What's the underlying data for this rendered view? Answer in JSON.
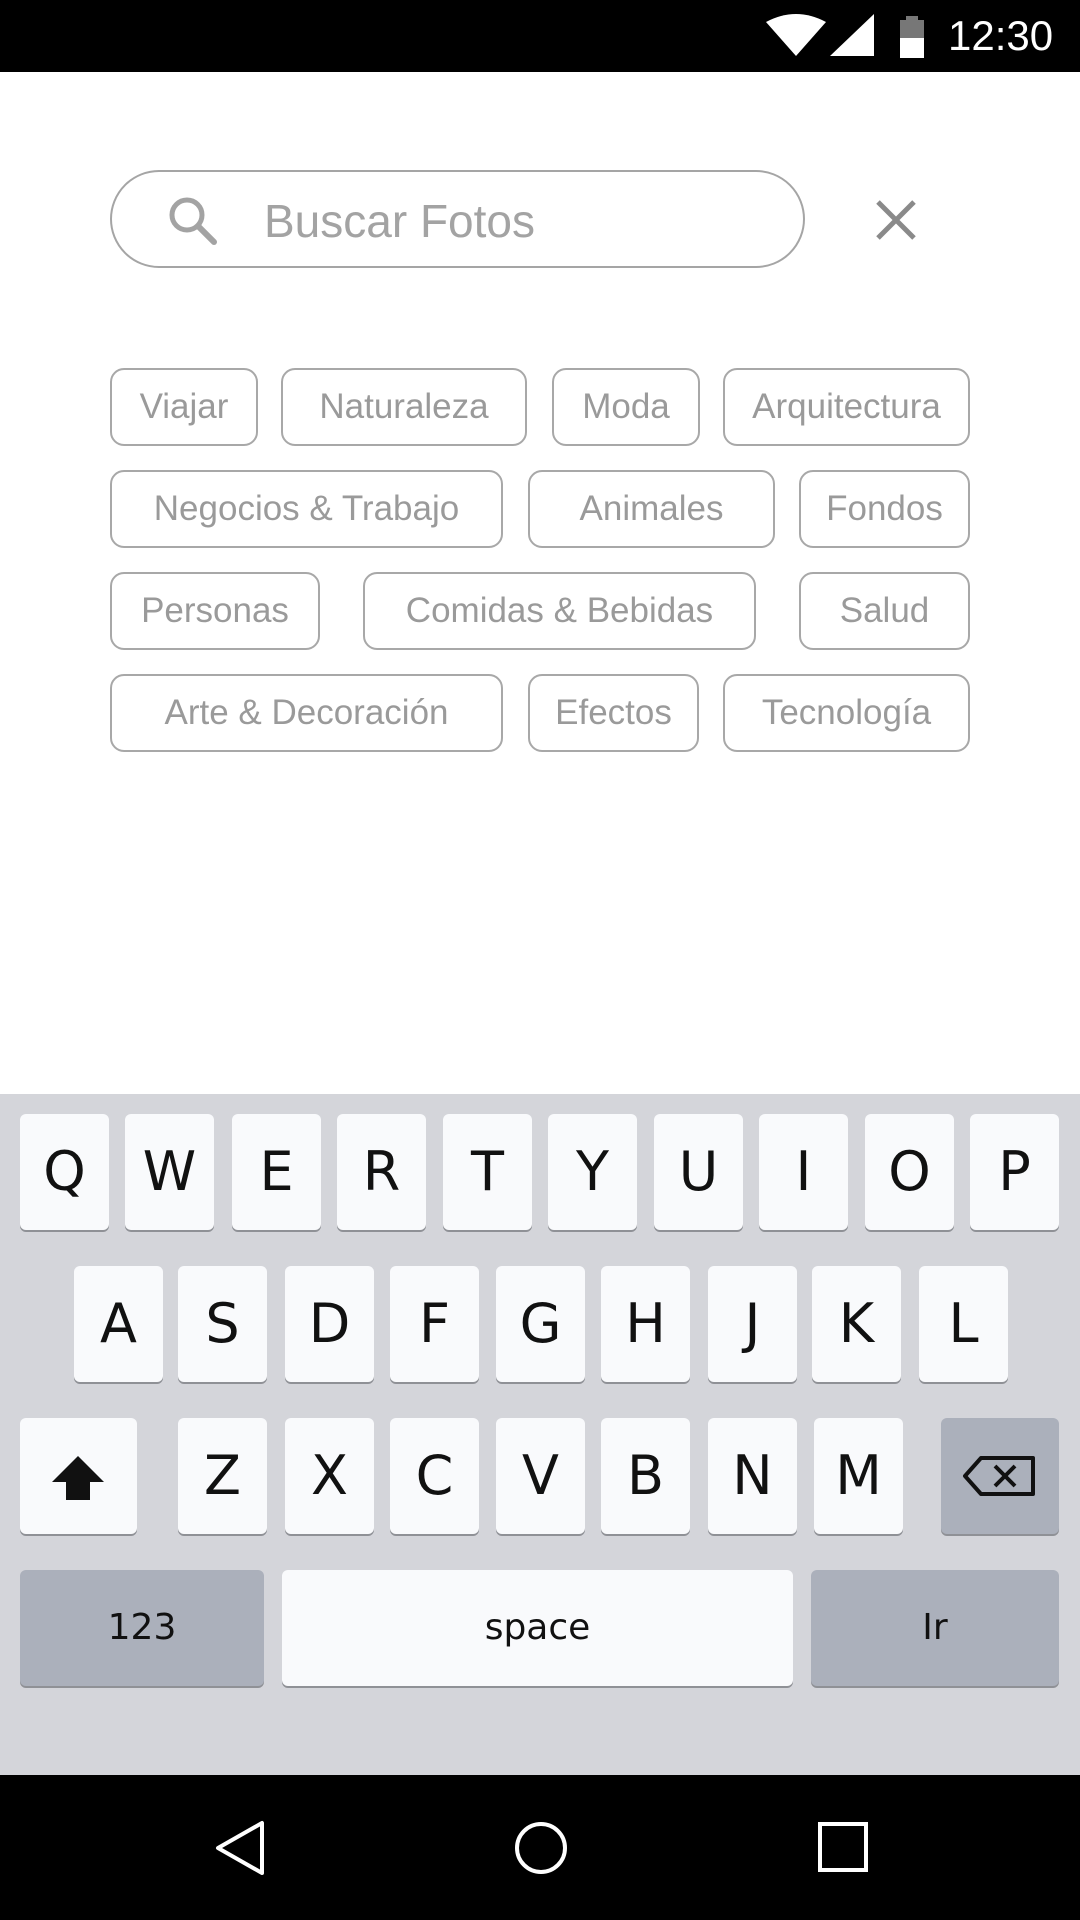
{
  "status_bar": {
    "time": "12:30",
    "icons": [
      "wifi-icon",
      "cell-signal-icon",
      "battery-icon"
    ]
  },
  "search": {
    "placeholder": "Buscar Fotos",
    "value": "",
    "icon": "search-icon",
    "close_icon": "close-icon"
  },
  "categories": [
    "Viajar",
    "Naturaleza",
    "Moda",
    "Arquitectura",
    "Negocios & Trabajo",
    "Animales",
    "Fondos",
    "Personas",
    "Comidas & Bebidas",
    "Salud",
    "Arte & Decoración",
    "Efectos",
    "Tecnología"
  ],
  "keyboard": {
    "row1": [
      "Q",
      "W",
      "E",
      "R",
      "T",
      "Y",
      "U",
      "I",
      "O",
      "P"
    ],
    "row2": [
      "A",
      "S",
      "D",
      "F",
      "G",
      "H",
      "J",
      "K",
      "L"
    ],
    "row3": [
      "Z",
      "X",
      "C",
      "V",
      "B",
      "N",
      "M"
    ],
    "numbers_label": "123",
    "space_label": "space",
    "go_label": "Ir",
    "shift_icon": "shift-icon",
    "backspace_icon": "backspace-icon"
  },
  "nav_bar": {
    "icons": [
      "back-icon",
      "home-icon",
      "recents-icon"
    ]
  }
}
